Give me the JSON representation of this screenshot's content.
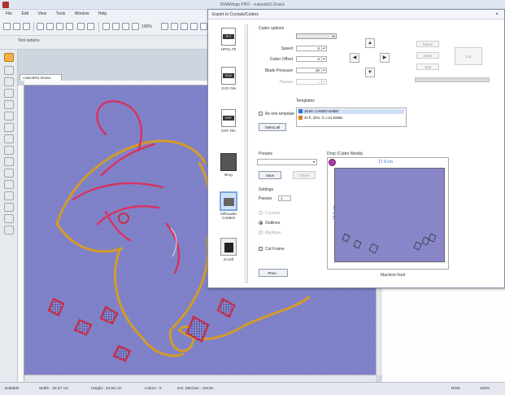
{
  "window": {
    "title": "DRAWings PRO - cutwork01.Draw1"
  },
  "menu": [
    "File",
    "Edit",
    "View",
    "Tools",
    "Window",
    "Help"
  ],
  "toolbar": {
    "zoom": "100%"
  },
  "tool_options": {
    "label": "Tool options"
  },
  "document": {
    "tab_label": "cutwork01.Draw1"
  },
  "status": {
    "mode": "Editable",
    "width": "Width : 20.67 cm",
    "height": "Height : 23.56 cm",
    "colors": "Colors : 5",
    "stitches": "Est. Stitches : 18445",
    "right": "RGB",
    "zoom": "100%"
  },
  "dialog": {
    "title": "Export to Crystals/Cutters",
    "close": "×",
    "file_types": [
      {
        "badge": "PLT",
        "label": "HPGL Plt"
      },
      {
        "badge": "SVG",
        "label": "SVG File"
      },
      {
        "badge": "DXF",
        "label": "DXF File"
      },
      {
        "badge": "",
        "label": "Brng"
      },
      {
        "badge": "",
        "label": "Silhouette CAMEO"
      },
      {
        "badge": "",
        "label": "eCraft"
      }
    ],
    "cutter_options": {
      "title": "Cutter options",
      "printer_label": "Printer",
      "speed_label": "Speed",
      "speed_value": "5",
      "offset_label": "Cutter Offset",
      "offset_value": "0",
      "blade_label": "Blade Pressure",
      "blade_value": "20",
      "passes_label": "Passes",
      "passes_value": "1"
    },
    "right_buttons": {
      "pause": "Pause",
      "abort": "Abort",
      "test": "Test",
      "cut": "Cut"
    },
    "templates": {
      "title": "Templates",
      "as_one_label": "As one template",
      "select_all": "Select all",
      "items": [
        {
          "text": "18.80, CAMEO 8x8B0",
          "color": "#2a6fcf"
        },
        {
          "text": "20 ft, 20m, G, L21.8x8B1",
          "color": "#e07b1a"
        }
      ]
    },
    "presets": {
      "title": "Presets",
      "save": "Save",
      "delete": "Delete"
    },
    "settings": {
      "title": "Settings",
      "passes_label": "Passes",
      "passes_value": "1",
      "crystals": "Crystals",
      "outlines": "Outlines",
      "applique": "Applique",
      "cut_frame": "Cut Frame",
      "print": "Print..."
    },
    "drop": {
      "title": "Drop (Cutter Media)",
      "width_label": "17.9 cm",
      "height_label": "16.8 cm",
      "machine_front": "Machine front"
    }
  },
  "colors": {
    "canvas": "#7d7fc6",
    "accent": "#2a6fcf",
    "thread_gold": "#d39b2a",
    "thread_red": "#d9325e",
    "diamond_red": "#c4304a"
  }
}
